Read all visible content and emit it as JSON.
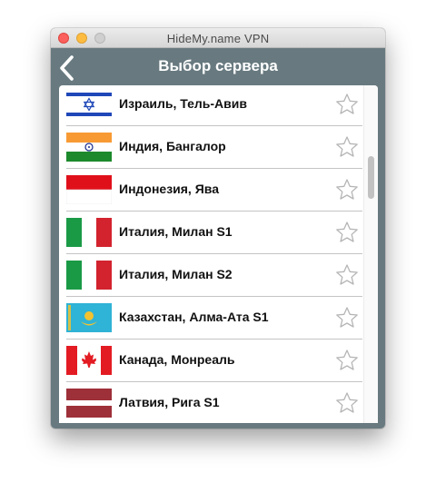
{
  "window": {
    "title": "HideMy.name VPN"
  },
  "appbar": {
    "title": "Выбор сервера",
    "back_icon": "chevron-left-icon"
  },
  "colors": {
    "appbar_background": "#687a80",
    "star_outline": "#b5b5b5"
  },
  "servers": [
    {
      "name": "Израиль, Тель-Авив",
      "flag": "israel-flag",
      "favorite": false
    },
    {
      "name": "Индия, Бангалор",
      "flag": "india-flag",
      "favorite": false
    },
    {
      "name": "Индонезия, Ява",
      "flag": "indonesia-flag",
      "favorite": false
    },
    {
      "name": "Италия, Милан S1",
      "flag": "italy-flag",
      "favorite": false
    },
    {
      "name": "Италия, Милан S2",
      "flag": "italy-flag",
      "favorite": false
    },
    {
      "name": "Казахстан, Алма-Ата S1",
      "flag": "kazakhstan-flag",
      "favorite": false
    },
    {
      "name": "Канада, Монреаль",
      "flag": "canada-flag",
      "favorite": false
    },
    {
      "name": "Латвия, Рига S1",
      "flag": "latvia-flag",
      "favorite": false
    }
  ]
}
